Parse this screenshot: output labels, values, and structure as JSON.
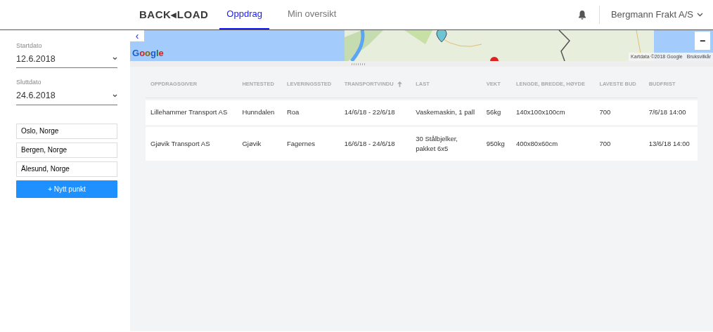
{
  "brand": "BACK◂LOAD",
  "tabs": [
    {
      "label": "Oppdrag",
      "selected": true
    },
    {
      "label": "Min oversikt",
      "selected": false
    }
  ],
  "account": {
    "name": "Bergmann Frakt A/S"
  },
  "filters": [
    {
      "label": "Startdato",
      "value": "12.6.2018"
    },
    {
      "label": "Sluttdato",
      "value": "24.6.2018"
    }
  ],
  "points": [
    "Oslo, Norge",
    "Bergen, Norge",
    "Ålesund, Norge"
  ],
  "add_button": "+ Nytt punkt",
  "map": {
    "kind": "picture",
    "logo": "Google",
    "attribution": "Kartdata ©2018 Google",
    "terms": "Bruksvilkår",
    "zoom_out": "−",
    "collapse": "‹"
  },
  "table": {
    "columns": [
      {
        "label": "OPPDRAGSGIVER",
        "sorted": false
      },
      {
        "label": "HENTESTED",
        "sorted": false
      },
      {
        "label": "LEVERINGSSTED",
        "sorted": false
      },
      {
        "label": "TRANSPORTVINDU",
        "sorted": true
      },
      {
        "label": "LAST",
        "sorted": false
      },
      {
        "label": "VEKT",
        "sorted": false
      },
      {
        "label": "LENGDE, BREDDE, HØYDE",
        "sorted": false
      },
      {
        "label": "LAVESTE BUD",
        "sorted": false
      },
      {
        "label": "BUDFRIST",
        "sorted": false
      }
    ],
    "rows": [
      [
        "Lillehammer Transport AS",
        "Hunndalen",
        "Roa",
        "14/6/18 - 22/6/18",
        "Vaskemaskin, 1 pall",
        "56kg",
        "140x100x100cm",
        "700",
        "7/6/18 14:00"
      ],
      [
        "Gjøvik Transport AS",
        "Gjøvik",
        "Fagernes",
        "16/6/18 - 24/6/18",
        "30 Stålbjelker, pakket 6x5",
        "950kg",
        "400x80x60cm",
        "700",
        "13/6/18 14:00"
      ]
    ]
  }
}
